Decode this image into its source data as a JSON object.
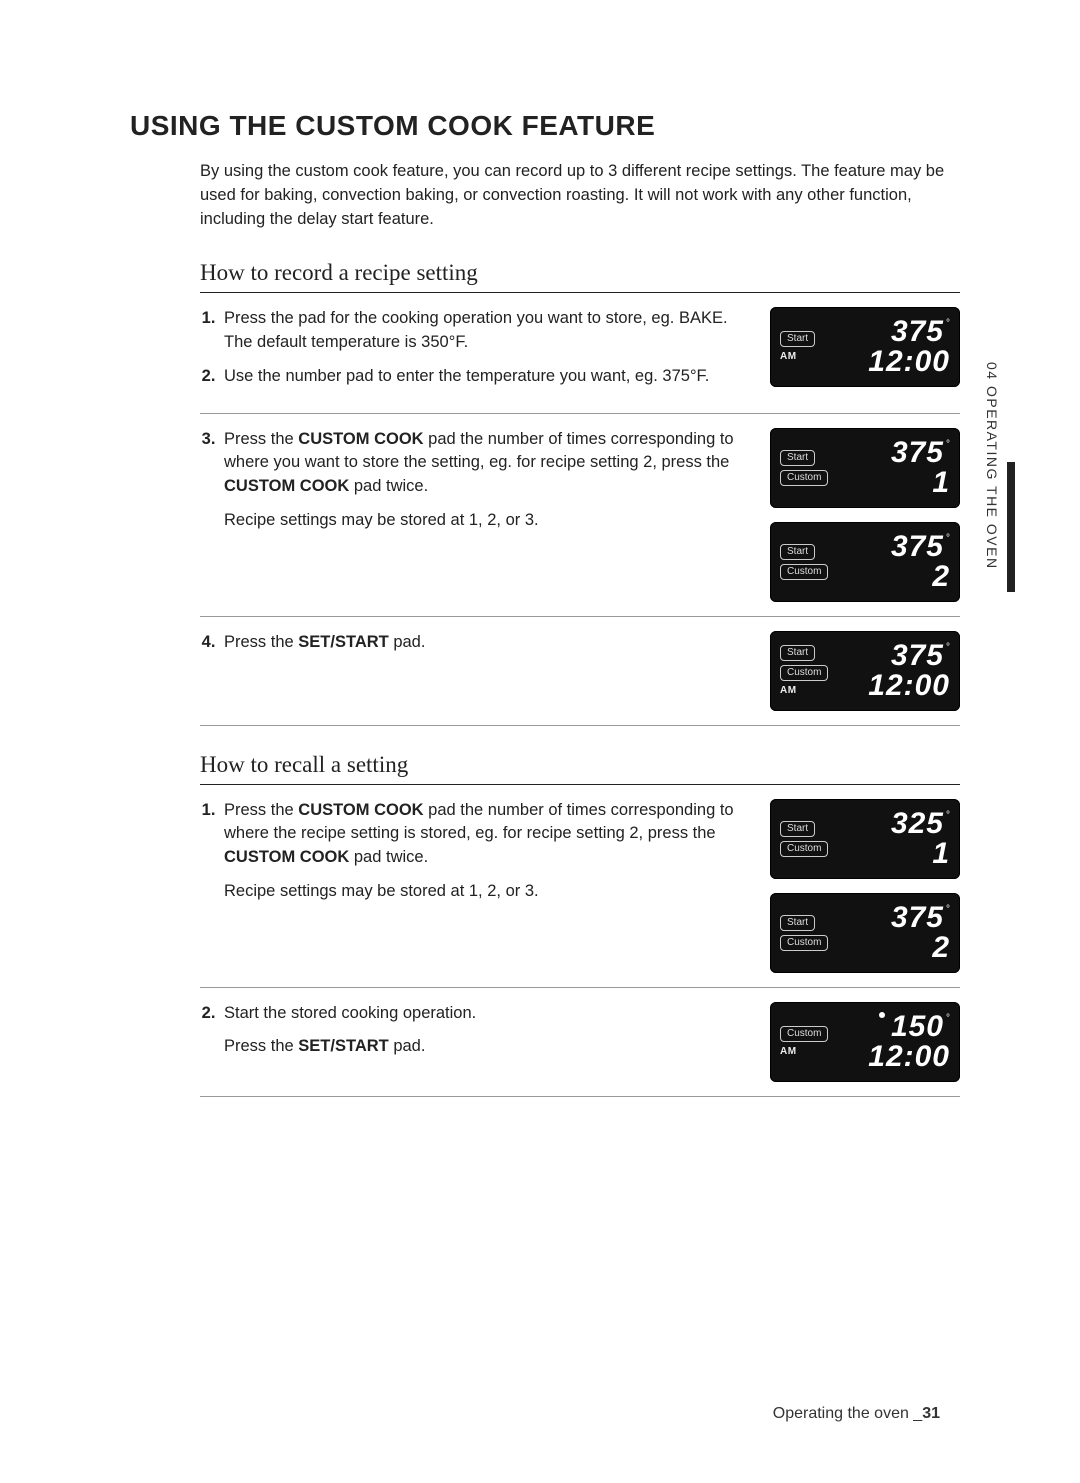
{
  "heading": "USING THE CUSTOM COOK FEATURE",
  "intro": "By using the custom cook feature, you can record up to 3 different recipe settings. The feature may be used for baking, convection baking, or convection roasting. It will not work with any other function, including the delay start feature.",
  "record": {
    "title": "How to record a recipe setting",
    "step1": "Press the pad for the cooking operation you want to store, eg. BAKE. The default temperature is 350°F.",
    "step2": "Use the number pad to enter the temperature you want, eg. 375°F.",
    "step3a": "Press the ",
    "step3b": " pad the number of times corresponding to where you want to store the setting, eg. for recipe setting 2, press the ",
    "step3c": " pad twice.",
    "step3note": "Recipe settings may be stored at 1, 2, or 3.",
    "step4a": "Press the ",
    "step4b": " pad.",
    "cc": "CUSTOM COOK",
    "ss": "SET/START"
  },
  "recall": {
    "title": "How to recall a setting",
    "step1a": "Press the ",
    "step1b": " pad the number of times corresponding to where the recipe setting is stored, eg. for recipe setting 2, press the ",
    "step1c": " pad twice.",
    "step1note": "Recipe settings may be stored at 1, 2, or 3.",
    "step2a": "Start the stored cooking operation.",
    "step2b": "Press the ",
    "step2c": " pad.",
    "cc": "CUSTOM COOK",
    "ss": "SET/START"
  },
  "labels": {
    "start": "Start",
    "custom": "Custom",
    "am": "AM",
    "deg": "°"
  },
  "displays": {
    "d1": {
      "temp": "375",
      "bottom": "12:00"
    },
    "d2": {
      "temp": "375",
      "bottom": "1"
    },
    "d3": {
      "temp": "375",
      "bottom": "2"
    },
    "d4": {
      "temp": "375",
      "bottom": "12:00"
    },
    "d5": {
      "temp": "325",
      "bottom": "1"
    },
    "d6": {
      "temp": "375",
      "bottom": "2"
    },
    "d7": {
      "temp": "150",
      "bottom": "12:00"
    }
  },
  "sideTab": "04  OPERATING THE OVEN",
  "footer": {
    "text": "Operating the oven _",
    "page": "31"
  }
}
